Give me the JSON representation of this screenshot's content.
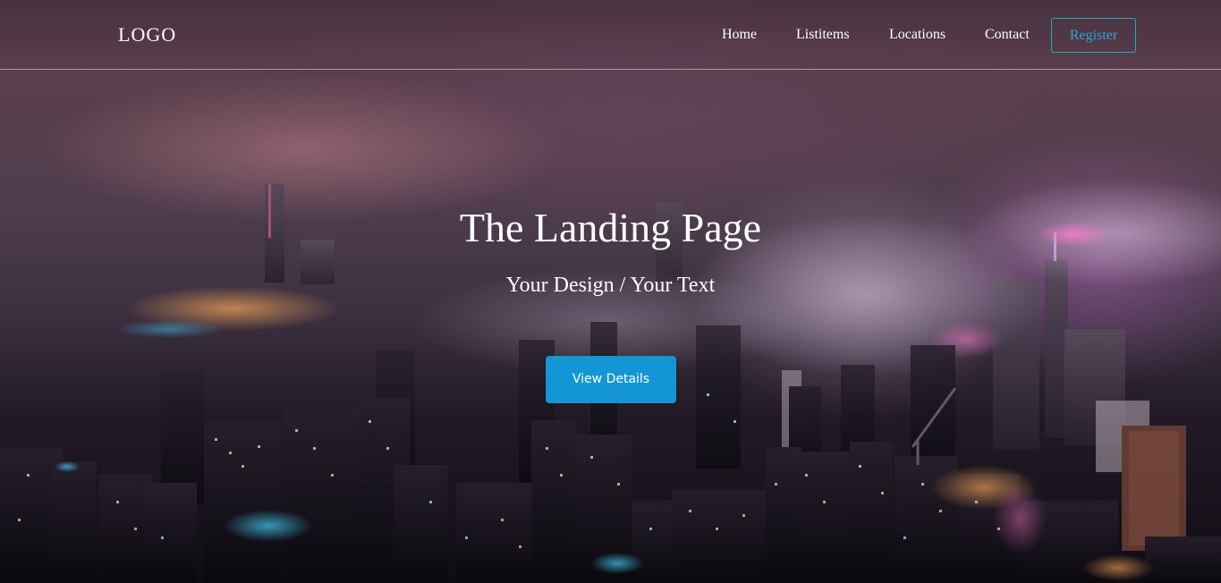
{
  "header": {
    "logo": "LOGO",
    "nav": [
      {
        "label": "Home"
      },
      {
        "label": "Listitems"
      },
      {
        "label": "Locations"
      },
      {
        "label": "Contact"
      }
    ],
    "register_label": "Register"
  },
  "hero": {
    "title": "The Landing Page",
    "subtitle": "Your Design / Your Text",
    "cta_label": "View Details",
    "background": "night-city-skyline-fog"
  },
  "colors": {
    "accent": "#1496d4",
    "register_border": "#1bb0b8",
    "register_text": "#26a6d8",
    "text": "#ffffff"
  }
}
